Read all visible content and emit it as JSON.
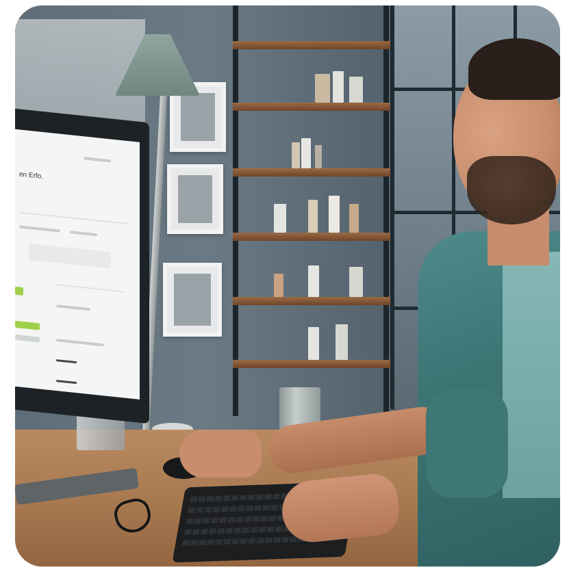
{
  "scene": {
    "description_tag": "photo",
    "colors": {
      "shirt": "#3d7575",
      "tee": "#86b7b6",
      "desk": "#a97a52",
      "screen_accent": "#9fd04a"
    }
  },
  "monitor": {
    "screen_heading": "en Erfo."
  }
}
